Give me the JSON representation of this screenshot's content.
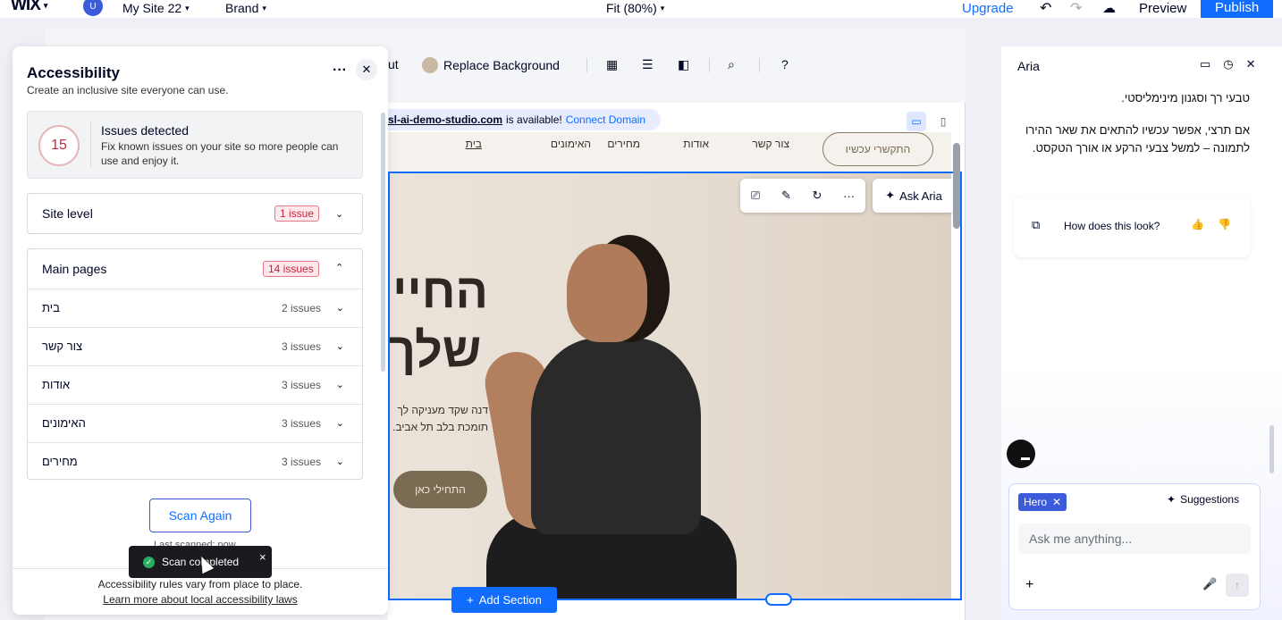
{
  "topbar": {
    "logo": "WIX",
    "avatar_letter": "U",
    "site_name": "My Site 22",
    "brand": "Brand",
    "zoom": "Fit (80%)",
    "upgrade": "Upgrade",
    "undo_icon": "undo-icon",
    "redo_icon": "redo-icon",
    "cloud_icon": "cloud-saved-icon",
    "preview": "Preview",
    "publish": "Publish"
  },
  "toolbar": {
    "cut_text": "ut",
    "replace_background": "Replace Background"
  },
  "domain_bar": {
    "domain": "sl-ai-demo-studio.com",
    "available": "is available!",
    "connect": "Connect Domain"
  },
  "site": {
    "nav": {
      "home": "בית",
      "trainings": "האימונים",
      "prices": "מחירים",
      "about": "אודות",
      "contact": "צור קשר",
      "cta": "התקשרי עכשיו"
    },
    "hero": {
      "title_line1": "החיים",
      "title_line2": "שלך",
      "sub_line1": "דנה שקד מעניקה לך",
      "sub_line2": "תומכת בלב תל אביב.",
      "button": "התחילי כאן"
    },
    "ask_aria": "Ask Aria",
    "more": "···",
    "add_section": "Add Section"
  },
  "accessibility": {
    "title": "Accessibility",
    "subtitle": "Create an inclusive site everyone can use.",
    "count": "15",
    "issues_title": "Issues detected",
    "issues_desc": "Fix known issues on your site so more people can use and enjoy it.",
    "site_level": {
      "label": "Site level",
      "badge": "1 issue"
    },
    "main_pages": {
      "label": "Main pages",
      "badge": "14 issues",
      "pages": [
        {
          "name": "בית",
          "count": "2 issues"
        },
        {
          "name": "צור קשר",
          "count": "3 issues"
        },
        {
          "name": "אודות",
          "count": "3 issues"
        },
        {
          "name": "האימונים",
          "count": "3 issues"
        },
        {
          "name": "מחירים",
          "count": "3 issues"
        }
      ]
    },
    "scan_again": "Scan Again",
    "last_scanned": "Last scanned: now",
    "footer_line1": "Accessibility rules vary from place to place.",
    "footer_link": "Learn more about local accessibility laws"
  },
  "toast": {
    "message": "Scan completed",
    "close": "×"
  },
  "aria": {
    "title": "Aria",
    "msg1": "טבעי רך וסגנון מינימליסטי.",
    "msg2": "אם תרצי, אפשר עכשיו להתאים את שאר ההירו לתמונה – למשל צבעי הרקע או אורך הטקסט.",
    "feedback": "How does this look?",
    "chip": "Hero",
    "suggestions": "Suggestions",
    "input_placeholder": "Ask me anything..."
  }
}
